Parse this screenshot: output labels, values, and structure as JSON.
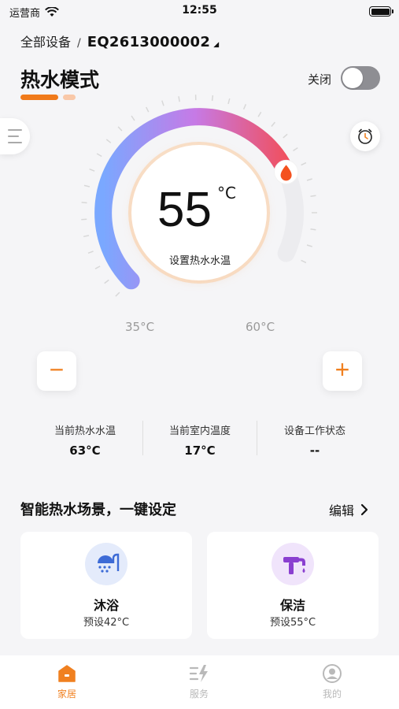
{
  "status_bar": {
    "carrier": "运营商",
    "time": "12:55"
  },
  "header": {
    "breadcrumb_root": "全部设备",
    "separator": "/",
    "device_id": "EQ2613000002",
    "device_caret": "◢"
  },
  "mode": {
    "title": "热水模式",
    "power_label": "关闭",
    "power_on": false
  },
  "dial": {
    "set_temp": "55",
    "unit": "°C",
    "caption": "设置热水水温",
    "min_label": "35°C",
    "max_label": "60°C",
    "min": 35,
    "max": 60,
    "value": 55,
    "colors": {
      "start": "#7aa8ff",
      "middle": "#c67ae6",
      "end": "#f0505f",
      "flame": "#f4511e"
    }
  },
  "controls": {
    "minus_label": "−",
    "plus_label": "+"
  },
  "stats": [
    {
      "label": "当前热水水温",
      "value": "63°C"
    },
    {
      "label": "当前室内温度",
      "value": "17°C"
    },
    {
      "label": "设备工作状态",
      "value": "--"
    }
  ],
  "scenes": {
    "title": "智能热水场景，一键设定",
    "edit_label": "编辑",
    "items": [
      {
        "name": "沐浴",
        "preset": "预设42°C",
        "icon": "shower-icon",
        "color": "#3d6bd6"
      },
      {
        "name": "保洁",
        "preset": "预设55°C",
        "icon": "faucet-icon",
        "color": "#8a3fd0"
      }
    ]
  },
  "tabs": [
    {
      "label": "家居",
      "icon": "home-icon",
      "active": true
    },
    {
      "label": "服务",
      "icon": "service-icon",
      "active": false
    },
    {
      "label": "我的",
      "icon": "profile-icon",
      "active": false
    }
  ],
  "accent": "#f08020"
}
